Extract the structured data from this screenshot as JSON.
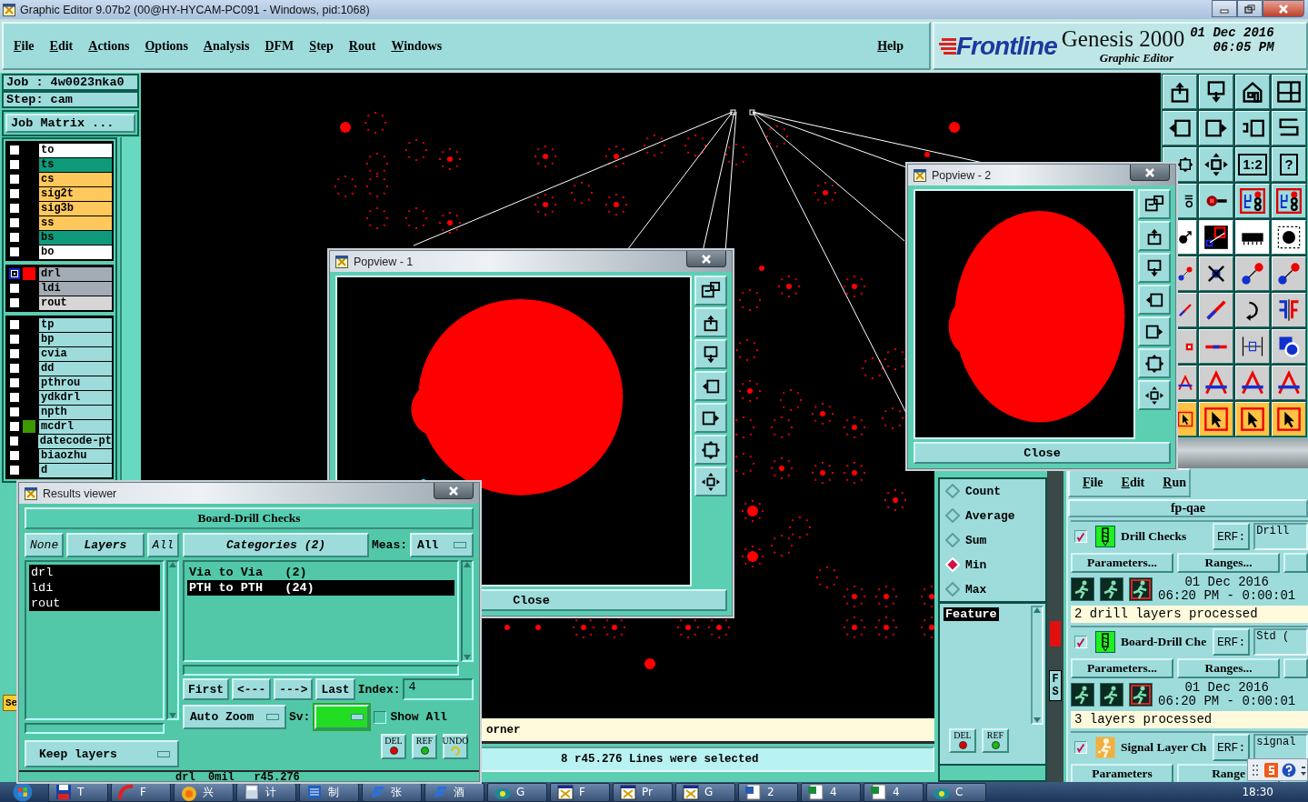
{
  "app_window": {
    "title": "Graphic Editor 9.07b2 (00@HY-HYCAM-PC091 - Windows, pid:1068)"
  },
  "menu": {
    "items": [
      "File",
      "Edit",
      "Actions",
      "Options",
      "Analysis",
      "DFM",
      "Step",
      "Rout",
      "Windows"
    ],
    "help": "Help"
  },
  "brand": {
    "logo": "Frontline",
    "product": "Genesis 2000",
    "module": "Graphic Editor",
    "date": "01 Dec 2016",
    "time": "06:05 PM"
  },
  "job_panel": {
    "job": "Job :  4w0023nka0",
    "step": "Step: cam",
    "matrix_button": "Job Matrix ...",
    "side_button": "Se"
  },
  "layer_groups": [
    {
      "layers": [
        {
          "name": "to",
          "color": "#ffffff",
          "active": false
        },
        {
          "name": "ts",
          "color": "#0f9b7b",
          "active": false
        },
        {
          "name": "cs",
          "color": "#ffc85c",
          "active": false
        },
        {
          "name": "sig2t",
          "color": "#ffc85c",
          "active": false
        },
        {
          "name": "sig3b",
          "color": "#ffc85c",
          "active": false
        },
        {
          "name": "ss",
          "color": "#ffc85c",
          "active": false
        },
        {
          "name": "bs",
          "color": "#0f9b7b",
          "active": false
        },
        {
          "name": "bo",
          "color": "#ffffff",
          "active": false
        }
      ]
    },
    {
      "layers": [
        {
          "name": "drl",
          "color": "#a3acb4",
          "active": true,
          "marker": {
            "color": "#ff0000"
          }
        },
        {
          "name": "ldi",
          "color": "#a3acb4",
          "active": false
        },
        {
          "name": "rout",
          "color": "#d6d6d6",
          "active": false
        }
      ]
    },
    {
      "layers": [
        {
          "name": "tp",
          "color": "#9edcdc",
          "active": false
        },
        {
          "name": "bp",
          "color": "#9edcdc",
          "active": false
        },
        {
          "name": "cvia",
          "color": "#9edcdc",
          "active": false
        },
        {
          "name": "dd",
          "color": "#9edcdc",
          "active": false
        },
        {
          "name": "pthrou",
          "color": "#9edcdc",
          "active": false
        },
        {
          "name": "ydkdrl",
          "color": "#9edcdc",
          "active": false
        },
        {
          "name": "npth",
          "color": "#9edcdc",
          "active": false
        },
        {
          "name": "mcdrl",
          "color": "#9edcdc",
          "active": false,
          "marker": {
            "color": "#3c9a00"
          }
        },
        {
          "name": "datecode-pt",
          "color": "#9edcdc",
          "active": false
        },
        {
          "name": "biaozhu",
          "color": "#9edcdc",
          "active": false
        },
        {
          "name": "d",
          "color": "#9edcdc",
          "active": false
        }
      ]
    }
  ],
  "tool_rows": [
    {
      "color": "#9edcdc",
      "tools": [
        {
          "kind": "tray-up"
        },
        {
          "kind": "tray-down"
        },
        {
          "kind": "house"
        },
        {
          "kind": "grid"
        }
      ]
    },
    {
      "color": "#9edcdc",
      "tools": [
        {
          "kind": "box-left"
        },
        {
          "kind": "box-right"
        },
        {
          "kind": "undo-box"
        },
        {
          "kind": "zigzag"
        }
      ]
    },
    {
      "color": "#9edcdc",
      "tools": [
        {
          "kind": "zoom-fit"
        },
        {
          "kind": "move"
        },
        {
          "kind": "label",
          "label": "1:2"
        },
        {
          "kind": "label",
          "label": "?"
        }
      ]
    },
    {
      "color": "#9edcdc",
      "tools": [
        {
          "kind": "wrench"
        },
        {
          "kind": "pad-line"
        },
        {
          "kind": "circuit"
        },
        {
          "kind": "circuit"
        }
      ]
    },
    {
      "color": "#ffffff",
      "tools": [
        {
          "kind": "pad-arrow"
        },
        {
          "kind": "measure"
        },
        {
          "kind": "ruler"
        },
        {
          "kind": "dot"
        }
      ]
    },
    {
      "color": "#cfcfcf",
      "tools": [
        {
          "kind": "two-dots"
        },
        {
          "kind": "cross"
        },
        {
          "kind": "two-dots"
        },
        {
          "kind": "two-dots"
        }
      ]
    },
    {
      "color": "#cfcfcf",
      "tools": [
        {
          "kind": "line"
        },
        {
          "kind": "line"
        },
        {
          "kind": "curve"
        },
        {
          "kind": "mirror"
        }
      ]
    },
    {
      "color": "#cfcfcf",
      "tools": [
        {
          "kind": "pad-square"
        },
        {
          "kind": "line-h"
        },
        {
          "kind": "dimension"
        },
        {
          "kind": "shapes"
        }
      ]
    },
    {
      "color": "#cfcfcf",
      "tools": [
        {
          "kind": "arch"
        },
        {
          "kind": "arch"
        },
        {
          "kind": "arch"
        },
        {
          "kind": "arch"
        }
      ]
    },
    {
      "color": "#ffc243",
      "tools": [
        {
          "kind": "cursor"
        },
        {
          "kind": "cursor"
        },
        {
          "kind": "cursor"
        },
        {
          "kind": "cursor"
        }
      ]
    }
  ],
  "popviews": [
    {
      "title": "Popview - 1",
      "close_button": "Close"
    },
    {
      "title": "Popview - 2",
      "close_button": "Close"
    }
  ],
  "results_viewer": {
    "title": "Results viewer",
    "header": "Board-Drill Checks",
    "layer_buttons": [
      "None",
      "Layers",
      "All"
    ],
    "layers": [
      {
        "name": "drl",
        "selected": true
      },
      {
        "name": "ldi",
        "selected": true
      },
      {
        "name": "rout",
        "selected": true
      }
    ],
    "keep_layers": "Keep layers",
    "categories_button": "Categories (2)",
    "meas_label": "Meas:",
    "meas_value": "All",
    "categories": [
      {
        "name": "Via to Via   (2)",
        "selected": false
      },
      {
        "name": "PTH to PTH   (24)",
        "selected": true
      }
    ],
    "nav_buttons": [
      "First",
      "<---",
      "--->",
      "Last"
    ],
    "index_label": "Index:",
    "index_value": "4",
    "zoom_mode": "Auto Zoom",
    "sv_label": "Sv:",
    "show_all": {
      "label": "Show All",
      "checked": false
    },
    "action_buttons": [
      {
        "label": "DEL",
        "kind": "del"
      },
      {
        "label": "REF",
        "kind": "ref"
      },
      {
        "label": "UNDO",
        "kind": "undo"
      }
    ],
    "footer": "drl  0mil   r45.276"
  },
  "measure_panel": {
    "options": [
      {
        "label": "Count",
        "selected": false
      },
      {
        "label": "Average",
        "selected": false
      },
      {
        "label": "Sum",
        "selected": false
      },
      {
        "label": "Min",
        "selected": true
      },
      {
        "label": "Max",
        "selected": false
      }
    ],
    "features": [
      {
        "name": "Feature",
        "selected": true
      }
    ],
    "buttons": [
      {
        "label": "DEL",
        "kind": "del"
      },
      {
        "label": "REF",
        "kind": "ref"
      }
    ]
  },
  "side_strip": {
    "texts": [
      "F",
      "S"
    ]
  },
  "qa_panel": {
    "menu": [
      "File",
      "Edit",
      "Run"
    ],
    "title": "fp-qae",
    "checks": [
      {
        "checked": true,
        "kind": "drill",
        "name": "Drill Checks",
        "erf_label": "ERF:",
        "erf_value": "Drill",
        "parameters": "Parameters...",
        "ranges": "Ranges...",
        "date": "01 Dec 2016",
        "time": "06:20 PM - 0:00:01",
        "status": "2 drill layers processed"
      },
      {
        "checked": true,
        "kind": "drill",
        "name": "Board-Drill Che",
        "erf_label": "ERF:",
        "erf_value": "Std (",
        "parameters": "Parameters...",
        "ranges": "Ranges...",
        "date": "01 Dec 2016",
        "time": "06:20 PM - 0:00:01",
        "status": "3 layers processed"
      },
      {
        "checked": true,
        "kind": "signal",
        "name": "Signal Layer Ch",
        "erf_label": "ERF:",
        "erf_value": "signal",
        "parameters": "Parameters",
        "ranges": "Range"
      }
    ]
  },
  "messages": {
    "prompt": "orner",
    "status": "8 r45.276 Lines were selected"
  },
  "taskbar": {
    "items": [
      {
        "label": "T",
        "kind": "disk"
      },
      {
        "label": "F",
        "kind": "curve"
      },
      {
        "label": "兴",
        "kind": "sun"
      },
      {
        "label": "计",
        "kind": "calc"
      },
      {
        "label": "制",
        "kind": "doc"
      },
      {
        "label": "张",
        "kind": "genesis"
      },
      {
        "label": "酒",
        "kind": "genesis"
      },
      {
        "label": "G",
        "kind": "eye"
      },
      {
        "label": "F",
        "kind": "win"
      },
      {
        "label": "Pr",
        "kind": "win"
      },
      {
        "label": "G",
        "kind": "win"
      },
      {
        "label": "2",
        "kind": "word"
      },
      {
        "label": "4",
        "kind": "excel"
      },
      {
        "label": "4",
        "kind": "excel"
      },
      {
        "label": "C",
        "kind": "eye"
      }
    ],
    "clock": "18:30"
  }
}
